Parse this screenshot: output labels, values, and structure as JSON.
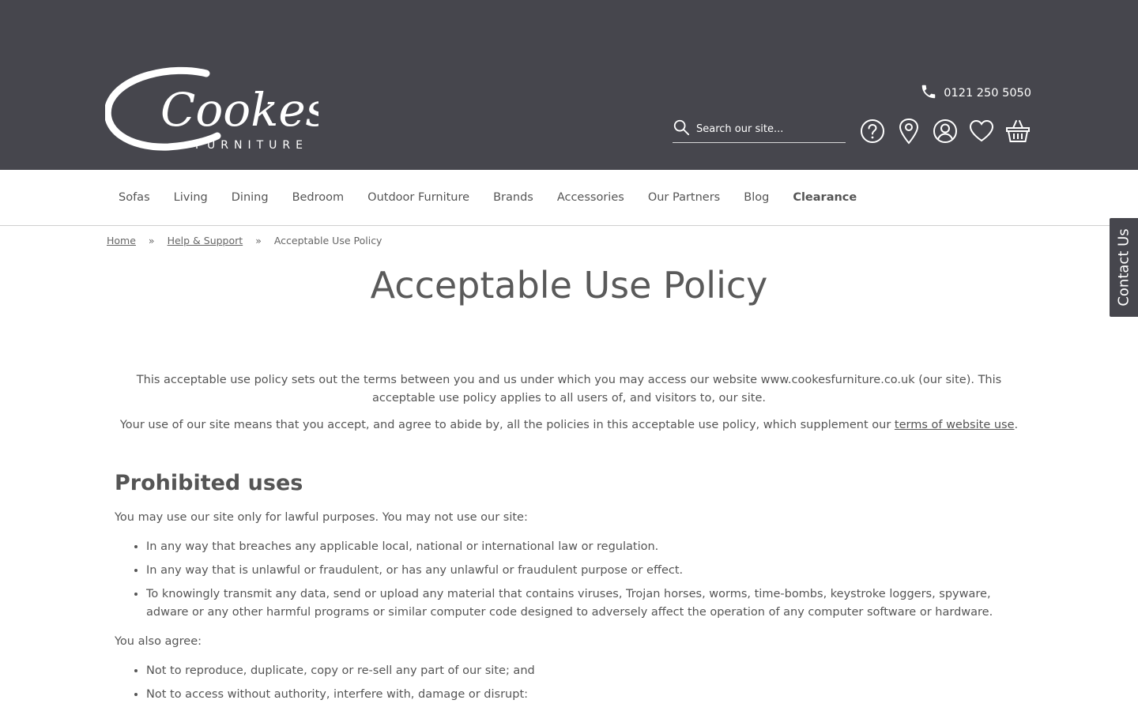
{
  "brand": {
    "name": "Cookes",
    "sub": "FURNITURE"
  },
  "header": {
    "phone": "0121 250 5050",
    "search_placeholder": "Search our site..."
  },
  "nav": [
    {
      "label": "Sofas"
    },
    {
      "label": "Living"
    },
    {
      "label": "Dining"
    },
    {
      "label": "Bedroom"
    },
    {
      "label": "Outdoor Furniture"
    },
    {
      "label": "Brands"
    },
    {
      "label": "Accessories"
    },
    {
      "label": "Our Partners"
    },
    {
      "label": "Blog"
    },
    {
      "label": "Clearance"
    }
  ],
  "contact_tab": "Contact Us",
  "breadcrumb": {
    "home": "Home",
    "sep": "»",
    "help": "Help & Support",
    "current": "Acceptable Use Policy"
  },
  "page": {
    "title": "Acceptable Use Policy",
    "intro1": "This acceptable use policy sets out the terms between you and us under which you may access our website www.cookesfurniture.co.uk (our site). This acceptable use policy applies to all users of, and visitors to, our site.",
    "intro2_before": "Your use of our site means that you accept, and agree to abide by, all the policies in this acceptable use policy, which supplement our ",
    "intro2_link": "terms of website use",
    "intro2_after": ".",
    "section_heading": "Prohibited uses",
    "section_intro": "You may use our site only for lawful purposes.  You may not use our site:",
    "list1": [
      "In any way that breaches any applicable local, national or international law or regulation.",
      "In any way that is unlawful or fraudulent, or has any unlawful or fraudulent purpose or effect.",
      "To knowingly transmit any data, send or upload any material that contains viruses, Trojan horses, worms, time-bombs, keystroke loggers, spyware, adware or any other harmful programs or similar computer code designed to adversely affect the operation of any computer software or hardware."
    ],
    "also_agree": "You also agree:",
    "list2": [
      "Not to reproduce, duplicate, copy or re-sell any part of our site; and",
      "Not to access without authority, interfere with, damage or disrupt:"
    ]
  },
  "icons": [
    "phone-icon",
    "search-icon",
    "help-icon",
    "location-icon",
    "account-icon",
    "wishlist-icon",
    "basket-icon"
  ],
  "colors": {
    "header_bg": "#46464d",
    "text": "#555555"
  }
}
